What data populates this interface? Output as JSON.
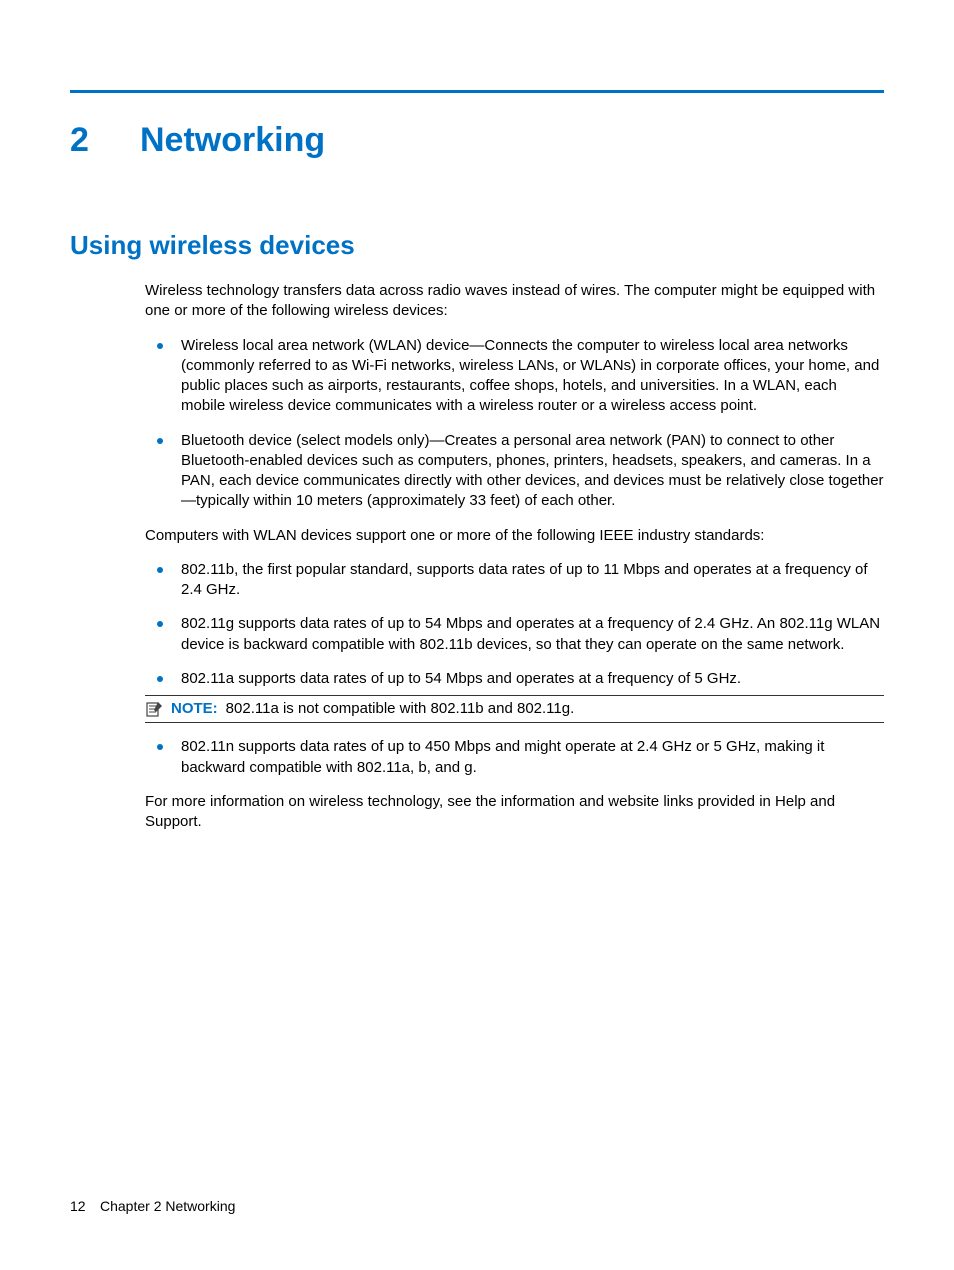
{
  "chapter": {
    "number": "2",
    "title": "Networking"
  },
  "section": {
    "title": "Using wireless devices"
  },
  "intro": "Wireless technology transfers data across radio waves instead of wires. The computer might be equipped with one or more of the following wireless devices:",
  "devices": [
    "Wireless local area network (WLAN) device—Connects the computer to wireless local area networks (commonly referred to as Wi-Fi networks, wireless LANs, or WLANs) in corporate offices, your home, and public places such as airports, restaurants, coffee shops, hotels, and universities. In a WLAN, each mobile wireless device communicates with a wireless router or a wireless access point.",
    "Bluetooth device (select models only)—Creates a personal area network (PAN) to connect to other Bluetooth-enabled devices such as computers, phones, printers, headsets, speakers, and cameras. In a PAN, each device communicates directly with other devices, and devices must be relatively close together—typically within 10 meters (approximately 33 feet) of each other."
  ],
  "standards_intro": "Computers with WLAN devices support one or more of the following IEEE industry standards:",
  "standards": [
    "802.11b, the first popular standard, supports data rates of up to 11 Mbps and operates at a frequency of 2.4 GHz.",
    "802.11g supports data rates of up to 54 Mbps and operates at a frequency of 2.4 GHz. An 802.11g WLAN device is backward compatible with 802.11b devices, so that they can operate on the same network.",
    "802.11a supports data rates of up to 54 Mbps and operates at a frequency of 5 GHz."
  ],
  "note": {
    "label": "NOTE:",
    "text": "802.11a is not compatible with 802.11b and 802.11g."
  },
  "standards_after": [
    "802.11n supports data rates of up to 450 Mbps and might operate at 2.4 GHz or 5 GHz, making it backward compatible with 802.11a, b, and g."
  ],
  "closing": "For more information on wireless technology, see the information and website links provided in Help and Support.",
  "footer": {
    "page": "12",
    "chapter_label": "Chapter 2   Networking"
  }
}
